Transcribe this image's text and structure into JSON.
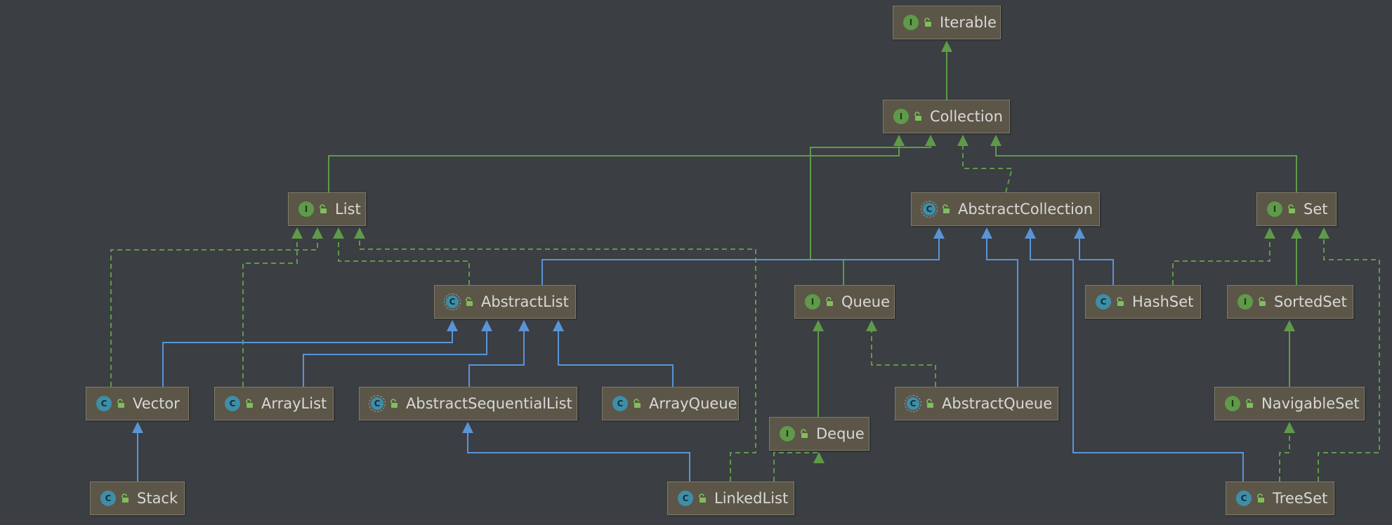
{
  "nodes": [
    {
      "id": "Iterable",
      "label": "Iterable",
      "kind": "interface",
      "kind_letter": "I"
    },
    {
      "id": "Collection",
      "label": "Collection",
      "kind": "interface",
      "kind_letter": "I"
    },
    {
      "id": "List",
      "label": "List",
      "kind": "interface",
      "kind_letter": "I"
    },
    {
      "id": "AbstractCollection",
      "label": "AbstractCollection",
      "kind": "abstract",
      "kind_letter": "C"
    },
    {
      "id": "Set",
      "label": "Set",
      "kind": "interface",
      "kind_letter": "I"
    },
    {
      "id": "AbstractList",
      "label": "AbstractList",
      "kind": "abstract",
      "kind_letter": "C"
    },
    {
      "id": "Queue",
      "label": "Queue",
      "kind": "interface",
      "kind_letter": "I"
    },
    {
      "id": "HashSet",
      "label": "HashSet",
      "kind": "class",
      "kind_letter": "C"
    },
    {
      "id": "SortedSet",
      "label": "SortedSet",
      "kind": "interface",
      "kind_letter": "I"
    },
    {
      "id": "Vector",
      "label": "Vector",
      "kind": "class",
      "kind_letter": "C"
    },
    {
      "id": "ArrayList",
      "label": "ArrayList",
      "kind": "class",
      "kind_letter": "C"
    },
    {
      "id": "AbstractSequentialList",
      "label": "AbstractSequentialList",
      "kind": "abstract",
      "kind_letter": "C"
    },
    {
      "id": "ArrayQueue",
      "label": "ArrayQueue",
      "kind": "class",
      "kind_letter": "C"
    },
    {
      "id": "Deque",
      "label": "Deque",
      "kind": "interface",
      "kind_letter": "I"
    },
    {
      "id": "AbstractQueue",
      "label": "AbstractQueue",
      "kind": "abstract",
      "kind_letter": "C"
    },
    {
      "id": "NavigableSet",
      "label": "NavigableSet",
      "kind": "interface",
      "kind_letter": "I"
    },
    {
      "id": "Stack",
      "label": "Stack",
      "kind": "class",
      "kind_letter": "C"
    },
    {
      "id": "LinkedList",
      "label": "LinkedList",
      "kind": "class",
      "kind_letter": "C"
    },
    {
      "id": "TreeSet",
      "label": "TreeSet",
      "kind": "class",
      "kind_letter": "C"
    }
  ],
  "edges": [
    {
      "from": "Collection",
      "to": "Iterable",
      "type": "extends"
    },
    {
      "from": "List",
      "to": "Collection",
      "type": "extends"
    },
    {
      "from": "Queue",
      "to": "Collection",
      "type": "extends"
    },
    {
      "from": "AbstractCollection",
      "to": "Collection",
      "type": "implements"
    },
    {
      "from": "Set",
      "to": "Collection",
      "type": "extends"
    },
    {
      "from": "Vector",
      "to": "List",
      "type": "implements"
    },
    {
      "from": "ArrayList",
      "to": "List",
      "type": "implements"
    },
    {
      "from": "AbstractList",
      "to": "List",
      "type": "implements"
    },
    {
      "from": "LinkedList",
      "to": "List",
      "type": "implements"
    },
    {
      "from": "AbstractList",
      "to": "AbstractCollection",
      "type": "inherits"
    },
    {
      "from": "AbstractQueue",
      "to": "AbstractCollection",
      "type": "inherits"
    },
    {
      "from": "TreeSet",
      "to": "AbstractCollection",
      "type": "inherits"
    },
    {
      "from": "HashSet",
      "to": "AbstractCollection",
      "type": "inherits"
    },
    {
      "from": "HashSet",
      "to": "Set",
      "type": "implements"
    },
    {
      "from": "SortedSet",
      "to": "Set",
      "type": "extends"
    },
    {
      "from": "TreeSet",
      "to": "Set",
      "type": "implements"
    },
    {
      "from": "Vector",
      "to": "AbstractList",
      "type": "inherits"
    },
    {
      "from": "ArrayList",
      "to": "AbstractList",
      "type": "inherits"
    },
    {
      "from": "AbstractSequentialList",
      "to": "AbstractList",
      "type": "inherits"
    },
    {
      "from": "ArrayQueue",
      "to": "AbstractList",
      "type": "inherits"
    },
    {
      "from": "Deque",
      "to": "Queue",
      "type": "extends"
    },
    {
      "from": "AbstractQueue",
      "to": "Queue",
      "type": "implements"
    },
    {
      "from": "NavigableSet",
      "to": "SortedSet",
      "type": "extends"
    },
    {
      "from": "Stack",
      "to": "Vector",
      "type": "inherits"
    },
    {
      "from": "LinkedList",
      "to": "AbstractSequentialList",
      "type": "inherits"
    },
    {
      "from": "LinkedList",
      "to": "Deque",
      "type": "implements"
    },
    {
      "from": "TreeSet",
      "to": "NavigableSet",
      "type": "implements"
    }
  ],
  "colors": {
    "background": "#3b3e42",
    "extends": "#5f9a4a",
    "implements": "#5f9a4a",
    "inherits": "#5a94d8",
    "node_fill": "#5b5648"
  }
}
